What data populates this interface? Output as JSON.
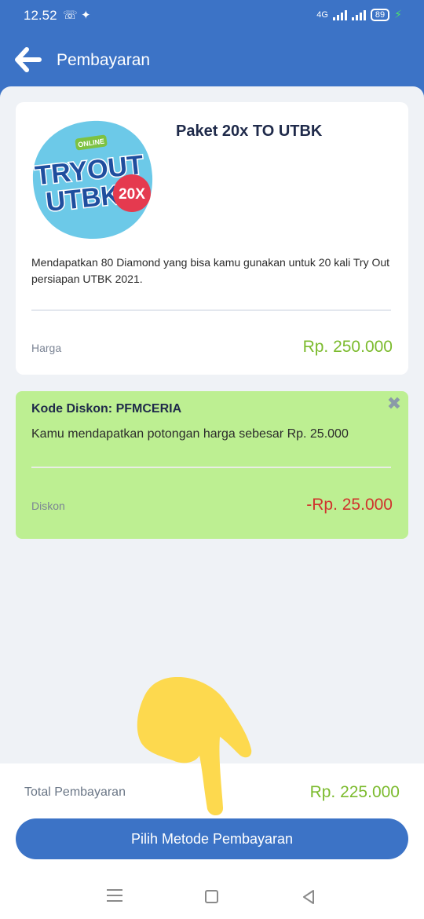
{
  "status": {
    "time": "12.52",
    "network": "4G",
    "battery": "89"
  },
  "header": {
    "title": "Pembayaran"
  },
  "product": {
    "logo_badge": "ONLINE",
    "logo_line1": "TRYOUT",
    "logo_line2": "UTBK",
    "logo_count": "20X",
    "title": "Paket 20x TO UTBK",
    "description": "Mendapatkan 80 Diamond yang bisa kamu gunakan untuk 20 kali Try Out persiapan UTBK 2021.",
    "price_label": "Harga",
    "price_value": "Rp. 250.000"
  },
  "discount": {
    "title": "Kode Diskon: PFMCERIA",
    "message": "Kamu mendapatkan potongan harga sebesar Rp. 25.000",
    "label": "Diskon",
    "value": "-Rp. 25.000"
  },
  "footer": {
    "total_label": "Total Pembayaran",
    "total_value": "Rp. 225.000",
    "button_label": "Pilih Metode Pembayaran"
  },
  "icons": {
    "back": "arrow-left-icon",
    "close": "close-icon",
    "whatsapp": "whatsapp-icon",
    "twitter": "twitter-icon"
  },
  "colors": {
    "primary": "#3c73c6",
    "price_green": "#7cbb2e",
    "discount_red": "#d0322d",
    "promo_bg": "#bdef92",
    "pointer_hand": "#fdd94e"
  }
}
